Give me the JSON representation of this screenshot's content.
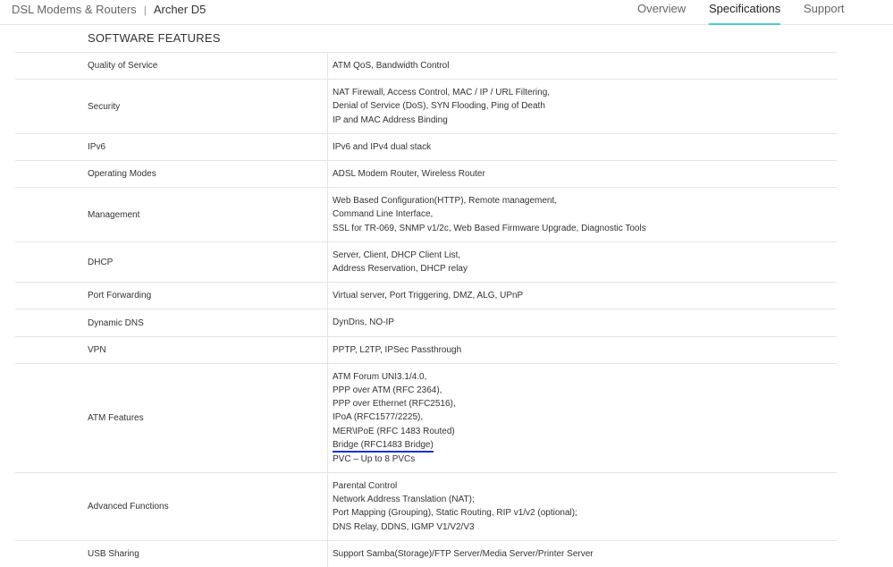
{
  "breadcrumb": {
    "category": "DSL Modems & Routers",
    "separator": "|",
    "product": "Archer D5"
  },
  "tabs": [
    {
      "label": "Overview",
      "active": false
    },
    {
      "label": "Specifications",
      "active": true
    },
    {
      "label": "Support",
      "active": false
    }
  ],
  "colors": {
    "active_tab_underline": "#4acbd6",
    "annotation_underline": "#1c2fd6"
  },
  "section_title": "SOFTWARE FEATURES",
  "rows": [
    {
      "label": "Quality of Service",
      "lines": [
        "ATM QoS, Bandwidth Control"
      ]
    },
    {
      "label": "Security",
      "lines": [
        "NAT Firewall, Access Control, MAC / IP / URL Filtering,",
        "Denial of Service (DoS), SYN Flooding, Ping of Death",
        "IP and MAC Address Binding"
      ]
    },
    {
      "label": "IPv6",
      "lines": [
        "IPv6 and IPv4 dual stack"
      ]
    },
    {
      "label": "Operating Modes",
      "lines": [
        "ADSL Modem Router, Wireless Router"
      ]
    },
    {
      "label": "Management",
      "lines": [
        "Web Based Configuration(HTTP), Remote management,",
        "Command Line Interface,",
        "SSL for TR-069, SNMP v1/2c, Web Based Firmware Upgrade, Diagnostic Tools"
      ]
    },
    {
      "label": "DHCP",
      "lines": [
        "Server, Client, DHCP Client List,",
        "Address Reservation, DHCP relay"
      ]
    },
    {
      "label": "Port Forwarding",
      "lines": [
        "Virtual server, Port Triggering, DMZ, ALG, UPnP"
      ]
    },
    {
      "label": "Dynamic DNS",
      "lines": [
        "DynDns, NO-IP"
      ]
    },
    {
      "label": "VPN",
      "lines": [
        "PPTP, L2TP, IPSec Passthrough"
      ]
    },
    {
      "label": "ATM Features",
      "lines": [
        "ATM Forum UNI3.1/4.0,",
        "PPP over ATM (RFC 2364),",
        "PPP over Ethernet (RFC2516),",
        "IPoA (RFC1577/2225),",
        "MER\\IPoE (RFC 1483 Routed)",
        "Bridge (RFC1483 Bridge)",
        "PVC – Up to 8 PVCs"
      ],
      "highlight_line": 5
    },
    {
      "label": "Advanced Functions",
      "lines": [
        "Parental Control",
        "Network Address Translation (NAT);",
        "Port Mapping (Grouping), Static Routing, RIP v1/v2 (optional);",
        "DNS Relay, DDNS, IGMP V1/V2/V3"
      ]
    },
    {
      "label": "USB Sharing",
      "lines": [
        "Support Samba(Storage)/FTP Server/Media Server/Printer Server"
      ]
    }
  ]
}
